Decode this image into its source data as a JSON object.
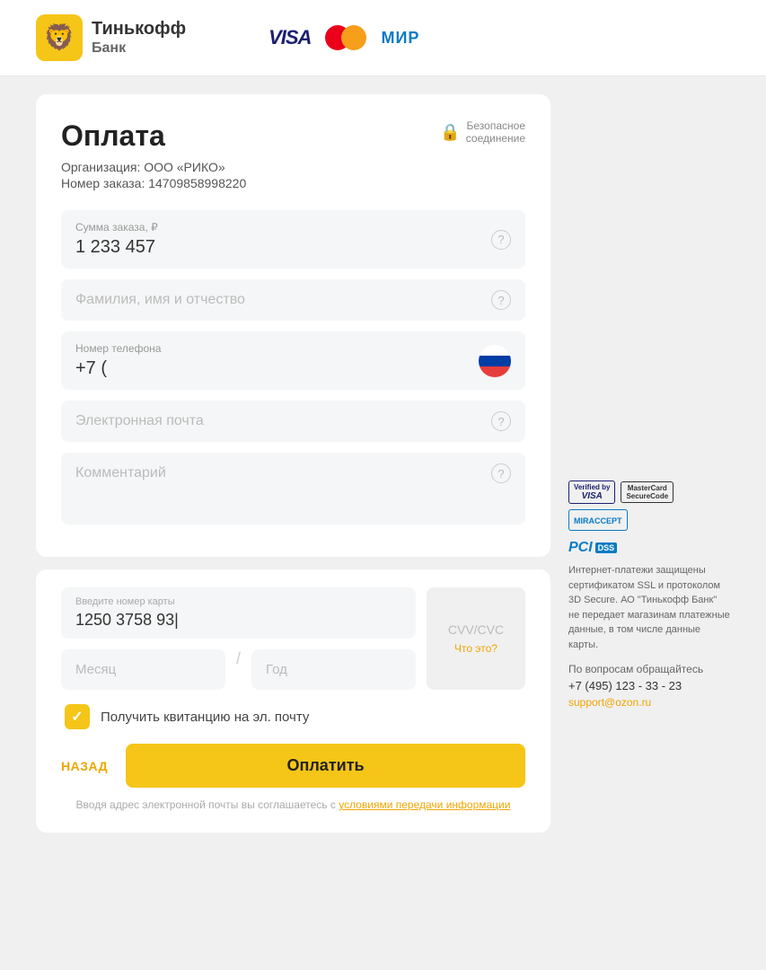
{
  "header": {
    "bank_name_line1": "Тинькофф",
    "bank_name_line2": "Банк",
    "visa_label": "VISA",
    "mir_label": "МИР"
  },
  "page": {
    "title": "Оплата",
    "secure_label": "Безопасное",
    "secure_label2": "соединение",
    "org_label": "Организация: ООО «РИКО»",
    "order_label": "Номер заказа: 14709858998220"
  },
  "form": {
    "amount_label": "Сумма заказа, ₽",
    "amount_value": "1 233 457",
    "name_placeholder": "Фамилия, имя и отчество",
    "phone_label": "Номер телефона",
    "phone_value": "+7 (",
    "email_placeholder": "Электронная почта",
    "comment_placeholder": "Комментарий"
  },
  "payment": {
    "card_label": "Введите номер карты",
    "card_value": "1250  3758  93",
    "month_placeholder": "Месяц",
    "year_placeholder": "Год",
    "cvv_label": "CVV/CVC",
    "cvv_help": "Что это?",
    "receipt_label": "Получить квитанцию на эл. почту"
  },
  "actions": {
    "back_label": "НАЗАД",
    "pay_label": "Оплатить"
  },
  "footer": {
    "text_before": "Вводя адрес электронной почты вы соглашаетесь с ",
    "link_text": "условиями передачи информации",
    "text_after": ""
  },
  "security": {
    "verified_line1": "Verified by",
    "verified_line2": "VISA",
    "mc_line1": "MasterCard",
    "mc_line2": "SecureCode",
    "mir_accept": "МIRACCEPT",
    "pci_label": "PCI DSS",
    "desc": "Интернет-платежи защищены сертификатом SSL и протоколом 3D Secure. АО \"Тинькофф Банк\" не передает магазинам платежные данные, в том числе данные карты.",
    "contact_title": "По вопросам обращайтесь",
    "phone": "+7 (495) 123 - 33 - 23",
    "email": "support@ozon.ru"
  }
}
